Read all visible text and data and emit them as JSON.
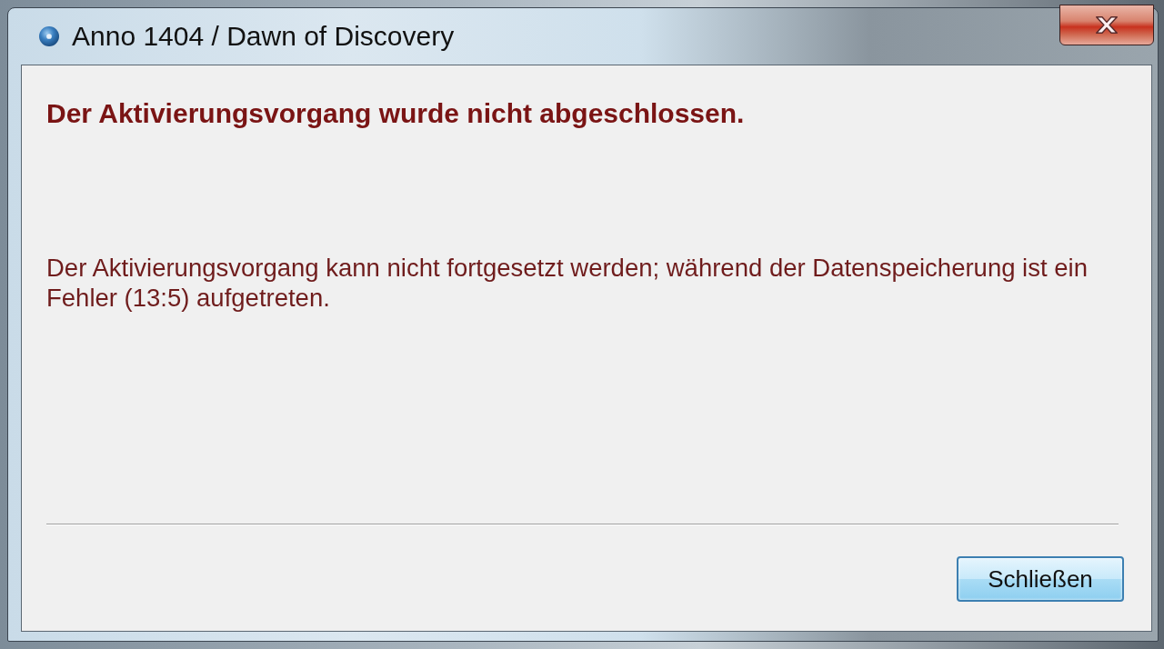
{
  "window": {
    "title": "Anno 1404 / Dawn of Discovery"
  },
  "dialog": {
    "heading": "Der Aktivierungsvorgang wurde nicht abgeschlossen.",
    "message": "Der Aktivierungsvorgang kann nicht fortgesetzt werden; während der Datenspeicherung ist ein Fehler (13:5) aufgetreten."
  },
  "buttons": [
    {
      "label": "Schließen",
      "focused": true
    }
  ]
}
